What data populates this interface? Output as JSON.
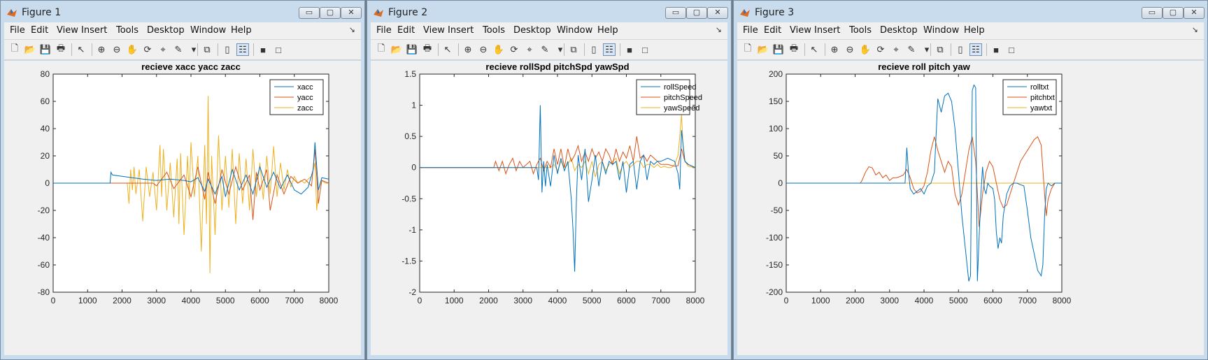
{
  "windows": [
    {
      "title": "Figure 1",
      "menus": [
        "File",
        "Edit",
        "View",
        "Insert",
        "Tools",
        "Desktop",
        "Window",
        "Help"
      ],
      "chart_data": {
        "type": "line",
        "title": "recieve xacc yacc zacc",
        "xlim": [
          0,
          8000
        ],
        "ylim": [
          -80,
          80
        ],
        "xticks": [
          0,
          1000,
          2000,
          3000,
          4000,
          5000,
          6000,
          7000,
          8000
        ],
        "yticks": [
          80,
          60,
          40,
          20,
          0,
          -20,
          -40,
          -60,
          -80
        ],
        "legend_position": "top-right",
        "series": [
          {
            "name": "xacc",
            "color": "#0072bd",
            "x": [
              0,
              1650,
              1680,
              1720,
              2000,
              2300,
              2600,
              3000,
              3400,
              3800,
              4000,
              4200,
              4400,
              4500,
              4700,
              4900,
              5000,
              5200,
              5400,
              5600,
              5800,
              6000,
              6200,
              6400,
              6600,
              6800,
              7000,
              7200,
              7400,
              7550,
              7600,
              7700,
              7800,
              8000
            ],
            "y": [
              0,
              0,
              8,
              6,
              5,
              4,
              3,
              2,
              3,
              2,
              1,
              4,
              -6,
              3,
              -8,
              5,
              -10,
              10,
              -5,
              6,
              -8,
              12,
              -3,
              8,
              -4,
              6,
              -5,
              -8,
              -3,
              10,
              30,
              -5,
              4,
              3
            ]
          },
          {
            "name": "yacc",
            "color": "#d95319",
            "x": [
              0,
              2900,
              3000,
              3300,
              3500,
              3800,
              4000,
              4200,
              4400,
              4500,
              4700,
              4900,
              5100,
              5300,
              5500,
              5700,
              5800,
              5900,
              6000,
              6200,
              6300,
              6500,
              6700,
              6900,
              7100,
              7300,
              7500,
              7600,
              7700,
              7800,
              8000
            ],
            "y": [
              0,
              0,
              -2,
              8,
              -4,
              6,
              -10,
              12,
              -12,
              8,
              -15,
              10,
              -8,
              12,
              -5,
              6,
              -27,
              8,
              -5,
              10,
              -20,
              6,
              -8,
              5,
              0,
              3,
              -2,
              25,
              -15,
              2,
              0
            ]
          },
          {
            "name": "zacc",
            "color": "#edb120",
            "x": [
              0,
              2150,
              2200,
              2250,
              2300,
              2350,
              2400,
              2500,
              2600,
              2700,
              2800,
              2900,
              3000,
              3100,
              3150,
              3200,
              3300,
              3400,
              3500,
              3600,
              3650,
              3700,
              3800,
              3900,
              3950,
              4000,
              4100,
              4200,
              4300,
              4400,
              4450,
              4500,
              4550,
              4600,
              4700,
              4800,
              4900,
              5000,
              5100,
              5200,
              5300,
              5400,
              5500,
              5600,
              5700,
              5800,
              5900,
              6000,
              6100,
              6200,
              6300,
              6400,
              6500,
              6600,
              6700,
              6800,
              6900,
              7000,
              7100,
              7200,
              7300,
              7400,
              7500,
              7600,
              7650,
              7700,
              7800,
              7900,
              8000
            ],
            "y": [
              0,
              0,
              -15,
              10,
              -5,
              12,
              -8,
              10,
              -28,
              12,
              -10,
              8,
              -20,
              28,
              -10,
              25,
              -20,
              15,
              -25,
              18,
              -30,
              22,
              -38,
              20,
              -12,
              30,
              -10,
              20,
              -50,
              28,
              -30,
              64,
              -66,
              20,
              -38,
              35,
              -20,
              20,
              -18,
              25,
              -30,
              22,
              -15,
              18,
              -20,
              25,
              -10,
              15,
              -12,
              20,
              -8,
              27,
              -10,
              15,
              -5,
              10,
              -3,
              5,
              0,
              2,
              0,
              3,
              5,
              15,
              -20,
              -5,
              2,
              0,
              0
            ]
          }
        ]
      }
    },
    {
      "title": "Figure 2",
      "menus": [
        "File",
        "Edit",
        "View",
        "Insert",
        "Tools",
        "Desktop",
        "Window",
        "Help"
      ],
      "chart_data": {
        "type": "line",
        "title": "recieve rollSpd pitchSpd yawSpd",
        "xlim": [
          0,
          8000
        ],
        "ylim": [
          -2,
          1.5
        ],
        "xticks": [
          0,
          1000,
          2000,
          3000,
          4000,
          5000,
          6000,
          7000,
          8000
        ],
        "yticks": [
          1.5,
          1,
          0.5,
          0,
          -0.5,
          -1,
          -1.5,
          -2
        ],
        "legend_position": "top-right",
        "series": [
          {
            "name": "rollSpeed",
            "color": "#0072bd",
            "x": [
              0,
              3400,
              3450,
              3500,
              3550,
              3600,
              3650,
              3700,
              3800,
              3900,
              4000,
              4100,
              4200,
              4300,
              4400,
              4450,
              4500,
              4550,
              4600,
              4700,
              4800,
              4900,
              5000,
              5100,
              5200,
              5300,
              5400,
              5500,
              5600,
              5700,
              5800,
              5900,
              6000,
              6100,
              6200,
              6300,
              6400,
              6500,
              6600,
              6700,
              6800,
              6900,
              7000,
              7200,
              7400,
              7500,
              7550,
              7600,
              7700,
              7800,
              8000
            ],
            "y": [
              0,
              0,
              -0.2,
              1.0,
              -0.4,
              0.1,
              -0.3,
              0.05,
              -0.3,
              0.2,
              -0.1,
              0.15,
              -0.05,
              0.1,
              -0.5,
              -1.0,
              -1.67,
              -0.5,
              0.2,
              -0.2,
              0.3,
              -0.55,
              -0.2,
              0.2,
              -0.3,
              0.1,
              -0.1,
              0.1,
              0.05,
              0.1,
              -0.2,
              0.1,
              -0.4,
              0.05,
              0.1,
              -0.35,
              0.1,
              0.2,
              -0.2,
              0.1,
              0.05,
              0.1,
              0.1,
              0.15,
              0.1,
              -0.1,
              -0.35,
              0.6,
              0.1,
              0.05,
              0.0
            ]
          },
          {
            "name": "pitchSpeed",
            "color": "#d95319",
            "x": [
              0,
              2150,
              2200,
              2300,
              2400,
              2500,
              2600,
              2700,
              2800,
              2900,
              3000,
              3100,
              3200,
              3300,
              3400,
              3500,
              3600,
              3700,
              3800,
              3900,
              4000,
              4100,
              4200,
              4300,
              4400,
              4500,
              4600,
              4700,
              4800,
              4900,
              5000,
              5100,
              5200,
              5300,
              5400,
              5500,
              5600,
              5700,
              5800,
              5900,
              6000,
              6100,
              6200,
              6300,
              6400,
              6500,
              6600,
              6700,
              6800,
              6900,
              7000,
              7200,
              7400,
              7500,
              7600,
              7700,
              7800,
              8000
            ],
            "y": [
              0,
              0,
              0.1,
              -0.05,
              0.1,
              -0.1,
              0.05,
              0.15,
              -0.05,
              0.1,
              0.0,
              0.05,
              0.1,
              -0.1,
              0.05,
              0.15,
              -0.05,
              0.1,
              0.0,
              0.3,
              0.05,
              0.3,
              0.0,
              0.3,
              0.1,
              0.2,
              0.35,
              0.1,
              0.25,
              0.1,
              0.3,
              0.15,
              0.25,
              0.1,
              0.3,
              0.2,
              0.05,
              0.3,
              0.1,
              0.25,
              0.15,
              0.35,
              0.1,
              0.5,
              0.15,
              0.2,
              0.1,
              0.2,
              0.15,
              0.1,
              0.05,
              0.05,
              0.02,
              0.03,
              0.3,
              0.1,
              0.05,
              0.0
            ]
          },
          {
            "name": "yawSpeed",
            "color": "#edb120",
            "x": [
              0,
              3800,
              3900,
              4000,
              4100,
              4200,
              4300,
              4400,
              4500,
              4600,
              4700,
              4800,
              4900,
              5000,
              5100,
              5200,
              5300,
              5400,
              5500,
              5600,
              5700,
              5800,
              5900,
              6000,
              6100,
              6200,
              6300,
              6400,
              6500,
              6600,
              6700,
              6800,
              6900,
              7000,
              7100,
              7200,
              7300,
              7400,
              7500,
              7550,
              7600,
              7650,
              7700,
              7800,
              8000
            ],
            "y": [
              0,
              0,
              0.05,
              -0.05,
              0.1,
              0.0,
              0.05,
              0.15,
              -0.05,
              0.05,
              0.0,
              0.1,
              -0.1,
              0.1,
              -0.15,
              0.05,
              0.1,
              -0.05,
              0.05,
              0.1,
              0.15,
              -0.1,
              0.05,
              0.1,
              0.0,
              0.05,
              0.1,
              0.1,
              0.0,
              0.05,
              0.05,
              0.0,
              0.05,
              0.0,
              0.02,
              0.0,
              0.0,
              0.05,
              0.2,
              0.5,
              0.85,
              0.3,
              0.1,
              0.02,
              0.0
            ]
          }
        ]
      }
    },
    {
      "title": "Figure 3",
      "menus": [
        "File",
        "Edit",
        "View",
        "Insert",
        "Tools",
        "Desktop",
        "Window",
        "Help"
      ],
      "chart_data": {
        "type": "line",
        "title": "recieve roll pitch yaw",
        "xlim": [
          0,
          8000
        ],
        "ylim": [
          -200,
          200
        ],
        "xticks": [
          0,
          1000,
          2000,
          3000,
          4000,
          5000,
          6000,
          7000,
          8000
        ],
        "yticks": [
          200,
          150,
          100,
          50,
          0,
          -50,
          -100,
          -150,
          -200
        ],
        "legend_position": "top-right",
        "series": [
          {
            "name": "rolltxt",
            "color": "#0072bd",
            "x": [
              0,
              3450,
              3500,
              3550,
              3600,
              3700,
              3800,
              3900,
              4000,
              4100,
              4200,
              4300,
              4400,
              4500,
              4600,
              4700,
              4800,
              4900,
              5000,
              5100,
              5200,
              5300,
              5350,
              5400,
              5450,
              5500,
              5550,
              5600,
              5650,
              5700,
              5750,
              5800,
              5850,
              5900,
              6000,
              6050,
              6100,
              6150,
              6200,
              6250,
              6300,
              6400,
              6500,
              6600,
              6700,
              6800,
              6900,
              7000,
              7100,
              7200,
              7300,
              7400,
              7450,
              7500,
              7550,
              7600,
              7700,
              7800,
              8000
            ],
            "y": [
              0,
              0,
              65,
              20,
              -10,
              -20,
              -15,
              -10,
              -20,
              -5,
              0,
              20,
              155,
              130,
              160,
              165,
              150,
              100,
              20,
              -60,
              -120,
              -180,
              -170,
              170,
              180,
              175,
              -180,
              -100,
              -20,
              30,
              -10,
              -20,
              0,
              -5,
              -10,
              -30,
              -90,
              -120,
              -100,
              -110,
              -60,
              -20,
              -5,
              0,
              0,
              -3,
              -5,
              -50,
              -100,
              -130,
              -160,
              -170,
              -150,
              -60,
              -10,
              0,
              -5,
              0,
              0
            ]
          },
          {
            "name": "pitchtxt",
            "color": "#d95319",
            "x": [
              0,
              2150,
              2200,
              2300,
              2400,
              2500,
              2600,
              2700,
              2800,
              2900,
              3000,
              3100,
              3200,
              3300,
              3400,
              3500,
              3600,
              3700,
              3800,
              3900,
              4000,
              4100,
              4200,
              4300,
              4400,
              4500,
              4600,
              4700,
              4800,
              4900,
              5000,
              5100,
              5200,
              5300,
              5400,
              5500,
              5600,
              5650,
              5700,
              5800,
              5900,
              6000,
              6100,
              6200,
              6300,
              6400,
              6500,
              6600,
              6700,
              6800,
              6900,
              7000,
              7100,
              7200,
              7300,
              7400,
              7500,
              7550,
              7600,
              7700,
              7800,
              8000
            ],
            "y": [
              0,
              0,
              5,
              20,
              30,
              28,
              15,
              20,
              10,
              15,
              5,
              10,
              10,
              12,
              15,
              25,
              10,
              -10,
              -18,
              -15,
              -5,
              20,
              60,
              85,
              60,
              40,
              20,
              40,
              30,
              -20,
              -40,
              -20,
              20,
              60,
              85,
              40,
              -80,
              -50,
              -20,
              20,
              40,
              30,
              0,
              -30,
              -45,
              -40,
              -20,
              0,
              20,
              40,
              50,
              60,
              70,
              80,
              85,
              70,
              -20,
              -60,
              -30,
              -10,
              0,
              0
            ]
          },
          {
            "name": "yawtxt",
            "color": "#edb120",
            "x": [
              0,
              8000
            ],
            "y": [
              0,
              0
            ]
          }
        ]
      }
    }
  ]
}
